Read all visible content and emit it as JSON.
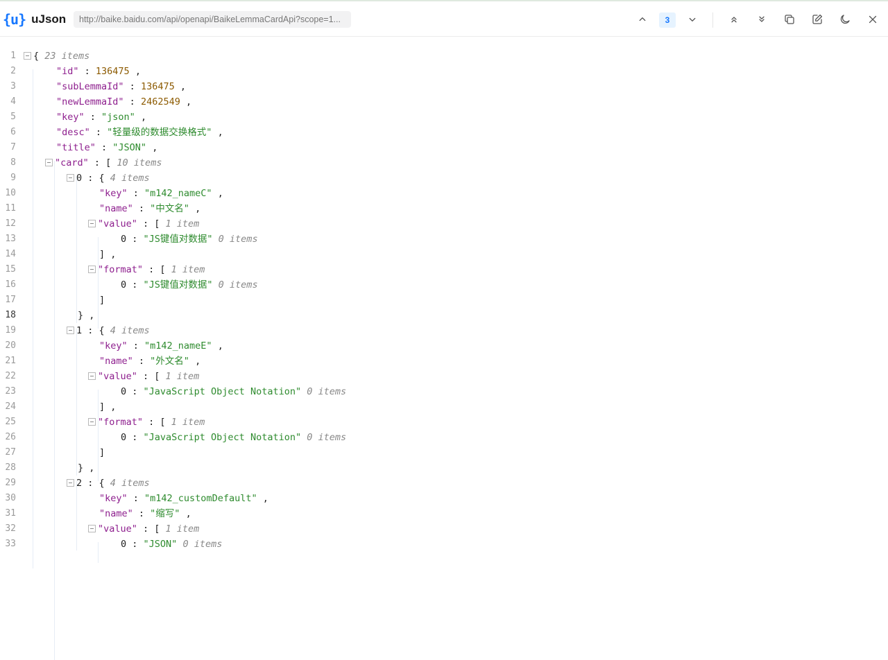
{
  "header": {
    "logo": "{u}",
    "app_name": "uJson",
    "url": "http://baike.baidu.com/api/openapi/BaikeLemmaCardApi?scope=1...",
    "match_count": "3",
    "icons": {
      "prev": "chevron-up-icon",
      "next": "chevron-down-icon",
      "expand_all": "double-chevron-up-icon",
      "collapse_all": "double-chevron-down-icon",
      "copy": "copy-icon",
      "edit": "edit-icon",
      "theme": "moon-icon",
      "close": "close-icon"
    }
  },
  "lines": [
    {
      "n": "1",
      "tokens": [
        [
          "fold",
          ""
        ],
        [
          "punc",
          "{ "
        ],
        [
          "meta",
          "23 items"
        ]
      ]
    },
    {
      "n": "2",
      "tokens": [
        [
          "key",
          "\"id\""
        ],
        [
          "punc",
          " : "
        ],
        [
          "num",
          "136475"
        ],
        [
          "punc",
          " ,"
        ]
      ]
    },
    {
      "n": "3",
      "tokens": [
        [
          "key",
          "\"subLemmaId\""
        ],
        [
          "punc",
          " : "
        ],
        [
          "num",
          "136475"
        ],
        [
          "punc",
          " ,"
        ]
      ]
    },
    {
      "n": "4",
      "tokens": [
        [
          "key",
          "\"newLemmaId\""
        ],
        [
          "punc",
          " : "
        ],
        [
          "num",
          "2462549"
        ],
        [
          "punc",
          " ,"
        ]
      ]
    },
    {
      "n": "5",
      "tokens": [
        [
          "key",
          "\"key\""
        ],
        [
          "punc",
          " : "
        ],
        [
          "str",
          "\"json\""
        ],
        [
          "punc",
          " ,"
        ]
      ]
    },
    {
      "n": "6",
      "tokens": [
        [
          "key",
          "\"desc\""
        ],
        [
          "punc",
          " : "
        ],
        [
          "str",
          "\"轻量级的数据交换格式\""
        ],
        [
          "punc",
          " ,"
        ]
      ]
    },
    {
      "n": "7",
      "tokens": [
        [
          "key",
          "\"title\""
        ],
        [
          "punc",
          " : "
        ],
        [
          "str",
          "\"JSON\""
        ],
        [
          "punc",
          " ,"
        ]
      ]
    },
    {
      "n": "8",
      "tokens": [
        [
          "fold",
          ""
        ],
        [
          "key",
          "\"card\""
        ],
        [
          "punc",
          " : [ "
        ],
        [
          "meta",
          "10 items"
        ]
      ]
    },
    {
      "n": "9",
      "tokens": [
        [
          "fold",
          ""
        ],
        [
          "punc",
          "0 : { "
        ],
        [
          "meta",
          "4 items"
        ]
      ]
    },
    {
      "n": "10",
      "tokens": [
        [
          "key",
          "\"key\""
        ],
        [
          "punc",
          " : "
        ],
        [
          "str",
          "\"m142_nameC\""
        ],
        [
          "punc",
          " ,"
        ]
      ]
    },
    {
      "n": "11",
      "tokens": [
        [
          "key",
          "\"name\""
        ],
        [
          "punc",
          " : "
        ],
        [
          "str",
          "\"中文名\""
        ],
        [
          "punc",
          " ,"
        ]
      ]
    },
    {
      "n": "12",
      "tokens": [
        [
          "fold",
          ""
        ],
        [
          "key",
          "\"value\""
        ],
        [
          "punc",
          " : [ "
        ],
        [
          "meta",
          "1 item"
        ]
      ]
    },
    {
      "n": "13",
      "tokens": [
        [
          "punc",
          "0 : "
        ],
        [
          "str",
          "\"JS键值对数据\""
        ],
        [
          "punc",
          " "
        ],
        [
          "meta",
          "0 items"
        ]
      ]
    },
    {
      "n": "14",
      "tokens": [
        [
          "punc",
          "] ,"
        ]
      ]
    },
    {
      "n": "15",
      "tokens": [
        [
          "fold",
          ""
        ],
        [
          "key",
          "\"format\""
        ],
        [
          "punc",
          " : [ "
        ],
        [
          "meta",
          "1 item"
        ]
      ]
    },
    {
      "n": "16",
      "tokens": [
        [
          "punc",
          "0 : "
        ],
        [
          "str",
          "\"JS键值对数据\""
        ],
        [
          "punc",
          " "
        ],
        [
          "meta",
          "0 items"
        ]
      ]
    },
    {
      "n": "17",
      "tokens": [
        [
          "punc",
          "]"
        ]
      ]
    },
    {
      "n": "18",
      "tokens": [
        [
          "punc",
          "} ,"
        ]
      ]
    },
    {
      "n": "19",
      "tokens": [
        [
          "fold",
          ""
        ],
        [
          "punc",
          "1 : { "
        ],
        [
          "meta",
          "4 items"
        ]
      ]
    },
    {
      "n": "20",
      "tokens": [
        [
          "key",
          "\"key\""
        ],
        [
          "punc",
          " : "
        ],
        [
          "str",
          "\"m142_nameE\""
        ],
        [
          "punc",
          " ,"
        ]
      ]
    },
    {
      "n": "21",
      "tokens": [
        [
          "key",
          "\"name\""
        ],
        [
          "punc",
          " : "
        ],
        [
          "str",
          "\"外文名\""
        ],
        [
          "punc",
          " ,"
        ]
      ]
    },
    {
      "n": "22",
      "tokens": [
        [
          "fold",
          ""
        ],
        [
          "key",
          "\"value\""
        ],
        [
          "punc",
          " : [ "
        ],
        [
          "meta",
          "1 item"
        ]
      ]
    },
    {
      "n": "23",
      "tokens": [
        [
          "punc",
          "0 : "
        ],
        [
          "str",
          "\"JavaScript Object Notation\""
        ],
        [
          "punc",
          " "
        ],
        [
          "meta",
          "0 items"
        ]
      ]
    },
    {
      "n": "24",
      "tokens": [
        [
          "punc",
          "] ,"
        ]
      ]
    },
    {
      "n": "25",
      "tokens": [
        [
          "fold",
          ""
        ],
        [
          "key",
          "\"format\""
        ],
        [
          "punc",
          " : [ "
        ],
        [
          "meta",
          "1 item"
        ]
      ]
    },
    {
      "n": "26",
      "tokens": [
        [
          "punc",
          "0 : "
        ],
        [
          "str",
          "\"JavaScript Object Notation\""
        ],
        [
          "punc",
          " "
        ],
        [
          "meta",
          "0 items"
        ]
      ]
    },
    {
      "n": "27",
      "tokens": [
        [
          "punc",
          "]"
        ]
      ]
    },
    {
      "n": "28",
      "tokens": [
        [
          "punc",
          "} ,"
        ]
      ]
    },
    {
      "n": "29",
      "tokens": [
        [
          "fold",
          ""
        ],
        [
          "punc",
          "2 : { "
        ],
        [
          "meta",
          "4 items"
        ]
      ]
    },
    {
      "n": "30",
      "tokens": [
        [
          "key",
          "\"key\""
        ],
        [
          "punc",
          " : "
        ],
        [
          "str",
          "\"m142_customDefault\""
        ],
        [
          "punc",
          " ,"
        ]
      ]
    },
    {
      "n": "31",
      "tokens": [
        [
          "key",
          "\"name\""
        ],
        [
          "punc",
          " : "
        ],
        [
          "str",
          "\"缩写\""
        ],
        [
          "punc",
          " ,"
        ]
      ]
    },
    {
      "n": "32",
      "tokens": [
        [
          "fold",
          ""
        ],
        [
          "key",
          "\"value\""
        ],
        [
          "punc",
          " : [ "
        ],
        [
          "meta",
          "1 item"
        ]
      ]
    },
    {
      "n": "33",
      "tokens": [
        [
          "punc",
          "0 : "
        ],
        [
          "str",
          "\"JSON\""
        ],
        [
          "punc",
          " "
        ],
        [
          "meta",
          "0 items"
        ]
      ]
    }
  ]
}
